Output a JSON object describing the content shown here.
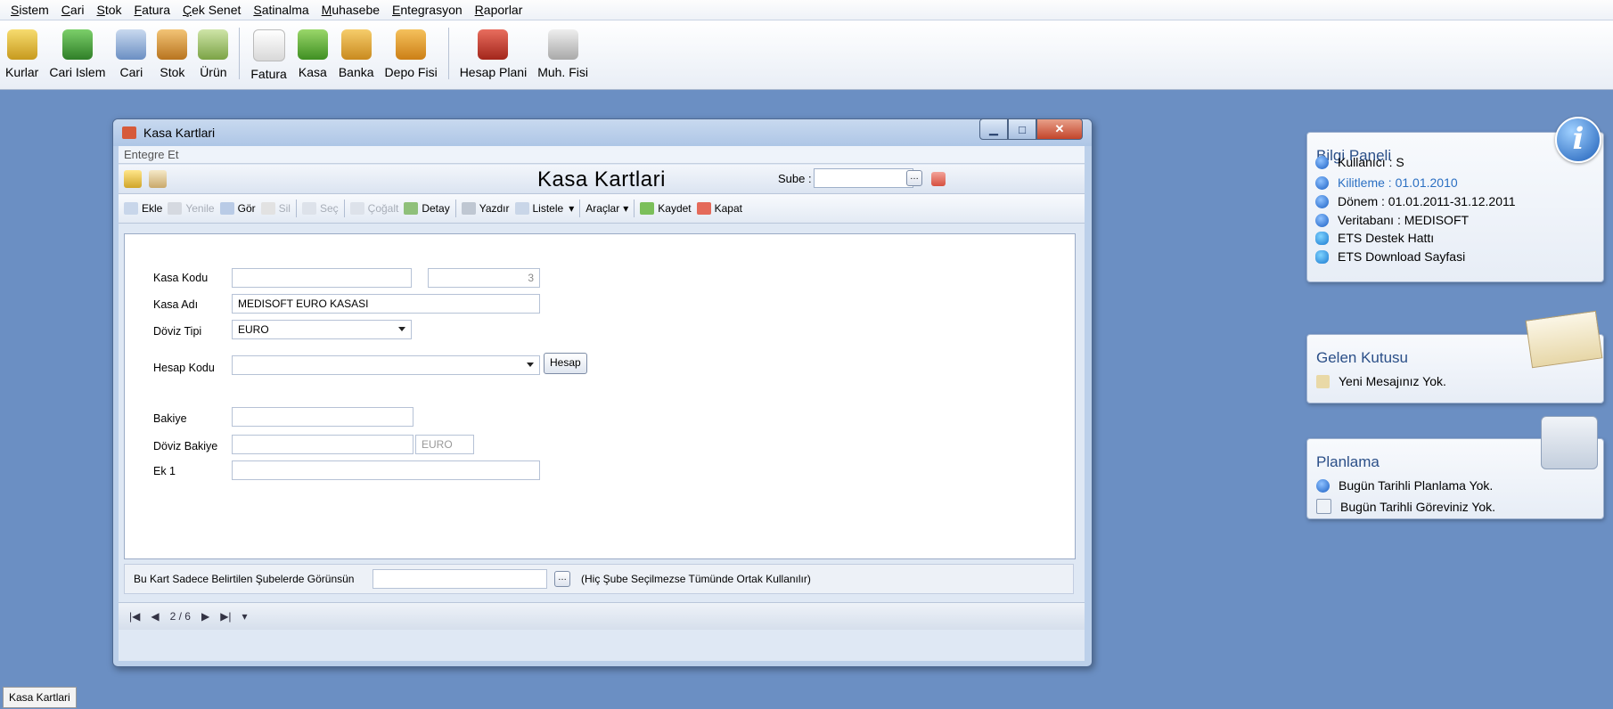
{
  "menu": [
    "Sistem",
    "Cari",
    "Stok",
    "Fatura",
    "Çek Senet",
    "Satinalma",
    "Muhasebe",
    "Entegrasyon",
    "Raporlar"
  ],
  "toolbar": [
    {
      "label": "Kurlar",
      "icon": "coins-icon",
      "color": "#e0b43a"
    },
    {
      "label": "Cari Islem",
      "icon": "money-icon",
      "color": "#3f9a36"
    },
    {
      "label": "Cari",
      "icon": "contact-card-icon",
      "color": "#6b8fc3"
    },
    {
      "label": "Stok",
      "icon": "box-icon",
      "color": "#d89a3a"
    },
    {
      "label": "Ürün",
      "icon": "product-icon",
      "color": "#8bb05a"
    },
    {
      "label": "Fatura",
      "icon": "document-icon",
      "color": "#e7e7e7"
    },
    {
      "label": "Kasa",
      "icon": "cash-icon",
      "color": "#5fa834"
    },
    {
      "label": "Banka",
      "icon": "bank-icon",
      "color": "#e2a63a"
    },
    {
      "label": "Depo Fisi",
      "icon": "warehouse-slip-icon",
      "color": "#e39b2e"
    },
    {
      "label": "Hesap Plani",
      "icon": "books-icon",
      "color": "#c53d2f"
    },
    {
      "label": "Muh. Fisi",
      "icon": "printer-icon",
      "color": "#bdbdbd"
    }
  ],
  "window": {
    "title": "Kasa Kartlari",
    "integrate_label": "Entegre Et",
    "header_title": "Kasa Kartlari",
    "sube_label": "Sube :",
    "sube_value": "",
    "commands": [
      {
        "label": "Ekle",
        "disabled": false
      },
      {
        "label": "Yenile",
        "disabled": true
      },
      {
        "label": "Gör",
        "disabled": false
      },
      {
        "label": "Sil",
        "disabled": true
      },
      {
        "label": "Seç",
        "disabled": true
      },
      {
        "label": "Çoğalt",
        "disabled": true
      },
      {
        "label": "Detay",
        "disabled": false
      },
      {
        "label": "Yazdır",
        "disabled": false
      },
      {
        "label": "Listele",
        "disabled": false
      },
      {
        "label": "Araçlar",
        "disabled": false
      },
      {
        "label": "Kaydet",
        "disabled": false
      },
      {
        "label": "Kapat",
        "disabled": false
      }
    ],
    "form": {
      "kasa_kodu_label": "Kasa Kodu",
      "kasa_kodu_value": "",
      "kasa_no": "3",
      "kasa_adi_label": "Kasa Adı",
      "kasa_adi_value": "MEDISOFT EURO KASASI",
      "doviz_tipi_label": "Döviz Tipi",
      "doviz_tipi_value": "EURO",
      "hesap_kodu_label": "Hesap Kodu",
      "hesap_kodu_value": "",
      "hesap_button": "Hesap",
      "bakiye_label": "Bakiye",
      "bakiye_value": "",
      "doviz_bakiye_label": "Döviz Bakiye",
      "doviz_bakiye_value": "",
      "doviz_bakiye_currency": "EURO",
      "ek1_label": "Ek 1",
      "ek1_value": ""
    },
    "branch_label": "Bu Kart Sadece Belirtilen Şubelerde Görünsün",
    "branch_value": "",
    "branch_note": "(Hiç Şube Seçilmezse Tümünde Ortak Kullanılır)",
    "nav_position": "2 / 6"
  },
  "bilgi_panel": {
    "title": "Bilgi Paneli",
    "rows": [
      {
        "text": "Kullanıcı : S",
        "link": false
      },
      {
        "text": "Kilitleme : 01.01.2010",
        "link": true
      },
      {
        "text": "Dönem : 01.01.2011-31.12.2011",
        "link": false
      },
      {
        "text": "Veritabanı : MEDISOFT",
        "link": false
      },
      {
        "text": "ETS Destek Hattı",
        "link": false
      },
      {
        "text": "ETS Download Sayfasi",
        "link": false
      }
    ]
  },
  "gelen_kutusu": {
    "title": "Gelen Kutusu",
    "message": "Yeni Mesajınız Yok."
  },
  "planlama": {
    "title": "Planlama",
    "rows": [
      "Bugün Tarihli Planlama Yok.",
      "Bugün Tarihli Göreviniz Yok."
    ]
  },
  "taskbar": {
    "item": "Kasa Kartlari"
  }
}
